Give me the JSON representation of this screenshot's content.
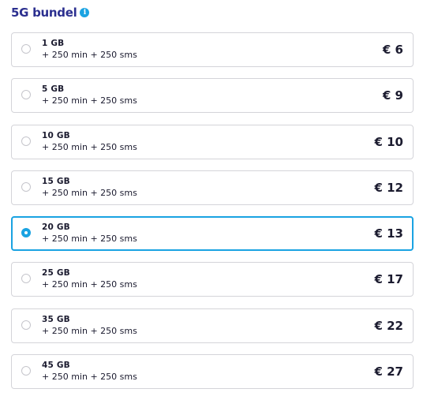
{
  "header": {
    "title": "5G bundel",
    "info_icon": "i"
  },
  "colors": {
    "title": "#2b2f8f",
    "accent": "#1aa3e2",
    "border": "#d4d4d9",
    "text": "#1b1b2f"
  },
  "selected_index": 4,
  "options": [
    {
      "data": "1 GB",
      "extras": "+ 250 min + 250 sms",
      "price": "€ 6"
    },
    {
      "data": "5 GB",
      "extras": "+ 250 min + 250 sms",
      "price": "€ 9"
    },
    {
      "data": "10 GB",
      "extras": "+ 250 min + 250 sms",
      "price": "€ 10"
    },
    {
      "data": "15 GB",
      "extras": "+ 250 min + 250 sms",
      "price": "€ 12"
    },
    {
      "data": "20 GB",
      "extras": "+ 250 min + 250 sms",
      "price": "€ 13"
    },
    {
      "data": "25 GB",
      "extras": "+ 250 min + 250 sms",
      "price": "€ 17"
    },
    {
      "data": "35 GB",
      "extras": "+ 250 min + 250 sms",
      "price": "€ 22"
    },
    {
      "data": "45 GB",
      "extras": "+ 250 min + 250 sms",
      "price": "€ 27"
    }
  ]
}
